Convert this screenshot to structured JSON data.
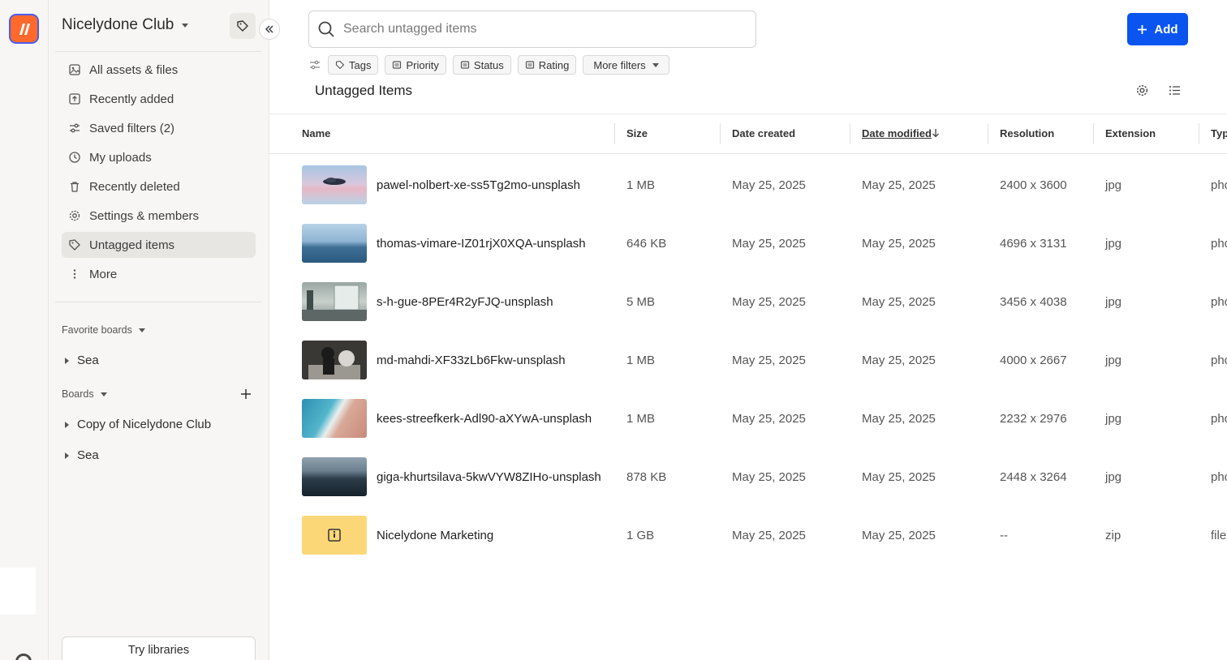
{
  "workspace": {
    "name": "Nicelydone Club"
  },
  "sidebar": {
    "nav": [
      {
        "label": "All assets & files",
        "icon": "images-icon"
      },
      {
        "label": "Recently added",
        "icon": "upload-box-icon"
      },
      {
        "label": "Saved filters (2)",
        "icon": "sliders-icon"
      },
      {
        "label": "My uploads",
        "icon": "clock-icon"
      },
      {
        "label": "Recently deleted",
        "icon": "trash-icon"
      },
      {
        "label": "Settings & members",
        "icon": "gear-icon"
      },
      {
        "label": "Untagged items",
        "icon": "tag-icon",
        "active": true
      },
      {
        "label": "More",
        "icon": "more-vertical-icon"
      }
    ],
    "favorite_boards": {
      "title": "Favorite boards",
      "items": [
        "Sea"
      ]
    },
    "boards": {
      "title": "Boards",
      "items": [
        "Copy of Nicelydone Club",
        "Sea"
      ]
    },
    "try_button": "Try libraries"
  },
  "search": {
    "placeholder": "Search untagged items"
  },
  "add_button": "Add",
  "filters": [
    "Tags",
    "Priority",
    "Status",
    "Rating"
  ],
  "more_filters": "More filters",
  "page_title": "Untagged Items",
  "table": {
    "columns": [
      "Name",
      "Size",
      "Date created",
      "Date modified",
      "Resolution",
      "Extension",
      "Typ"
    ],
    "rows": [
      {
        "name": "pawel-nolbert-xe-ss5Tg2mo-unsplash",
        "size": "1 MB",
        "created": "May 25, 2025",
        "modified": "May 25, 2025",
        "resolution": "2400 x 3600",
        "ext": "jpg",
        "type": "pho"
      },
      {
        "name": "thomas-vimare-IZ01rjX0XQA-unsplash",
        "size": "646 KB",
        "created": "May 25, 2025",
        "modified": "May 25, 2025",
        "resolution": "4696 x 3131",
        "ext": "jpg",
        "type": "pho"
      },
      {
        "name": "s-h-gue-8PEr4R2yFJQ-unsplash",
        "size": "5 MB",
        "created": "May 25, 2025",
        "modified": "May 25, 2025",
        "resolution": "3456 x 4038",
        "ext": "jpg",
        "type": "pho"
      },
      {
        "name": "md-mahdi-XF33zLb6Fkw-unsplash",
        "size": "1 MB",
        "created": "May 25, 2025",
        "modified": "May 25, 2025",
        "resolution": "4000 x 2667",
        "ext": "jpg",
        "type": "pho"
      },
      {
        "name": "kees-streefkerk-Adl90-aXYwA-unsplash",
        "size": "1 MB",
        "created": "May 25, 2025",
        "modified": "May 25, 2025",
        "resolution": "2232 x 2976",
        "ext": "jpg",
        "type": "pho"
      },
      {
        "name": "giga-khurtsilava-5kwVYW8ZIHo-unsplash",
        "size": "878 KB",
        "created": "May 25, 2025",
        "modified": "May 25, 2025",
        "resolution": "2448 x 3264",
        "ext": "jpg",
        "type": "pho"
      },
      {
        "name": "Nicelydone Marketing",
        "size": "1 GB",
        "created": "May 25, 2025",
        "modified": "May 25, 2025",
        "resolution": "--",
        "ext": "zip",
        "type": "file"
      }
    ]
  },
  "colors": {
    "accent": "#0a55f0",
    "logo": "#ff6a2c",
    "active_nav": "#e8e6e3",
    "folder": "#fcd778"
  }
}
